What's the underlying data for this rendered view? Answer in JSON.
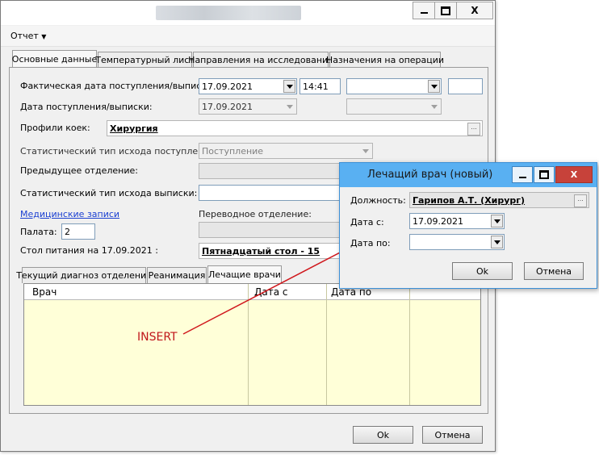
{
  "window": {
    "close_glyph": "X",
    "menu": {
      "report_label": "Отчет"
    }
  },
  "main_tabs": [
    "Основные данные",
    "Температурный лист",
    "Направления на исследования",
    "Назначения на операции"
  ],
  "form": {
    "actual_date_label": "Фактическая дата поступления/выписки:",
    "actual_date_value": "17.09.2021",
    "actual_time_value": "14:41",
    "admit_date_label": "Дата поступления/выписки:",
    "admit_date_value": "17.09.2021",
    "bed_profiles_label": "Профили коек:",
    "bed_profiles_value": "Хирургия",
    "stat_admit_label": "Статистический тип исхода поступления:",
    "stat_admit_value": "Поступление",
    "prev_dept_label": "Предыдущее отделение:",
    "stat_discharge_label": "Статистический тип исхода выписки:",
    "medical_records_link": "Медицинские записи",
    "transfer_dept_label": "Переводное отделение:",
    "ward_label": "Палата:",
    "ward_value": "2",
    "diet_label": "Стол питания на 17.09.2021 :",
    "diet_value": "Пятнадцатый стол - 15"
  },
  "sub_tabs": [
    "Текущий диагноз отделения",
    "Реанимация",
    "Лечащие врачи"
  ],
  "doctors_grid": {
    "columns": [
      "Врач",
      "Дата с",
      "Дата по"
    ]
  },
  "annotation": {
    "text": "INSERT",
    "color": "#d0181d"
  },
  "footer": {
    "ok_label": "Ok",
    "cancel_label": "Отмена"
  },
  "dialog": {
    "title": "Лечащий врач (новый)",
    "position_label": "Должность:",
    "position_value": "Гарипов А.Т. (Хирург)",
    "date_from_label": "Дата с:",
    "date_from_value": "17.09.2021",
    "date_to_label": "Дата по:",
    "date_to_value": "",
    "ok_label": "Ok",
    "cancel_label": "Отмена"
  }
}
